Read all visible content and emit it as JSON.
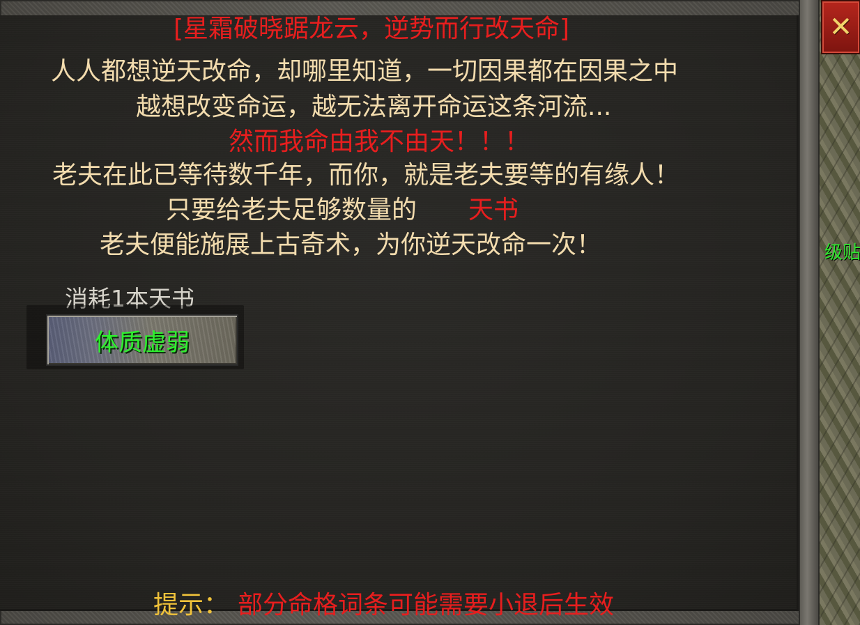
{
  "dialog": {
    "title": "[星霜破晓踞龙云，逆势而行改天命]",
    "lines": [
      "人人都想逆天改命，却哪里知道，一切因果都在因果之中",
      "越想改变命运，越无法离开命运这条河流...",
      "然而我命由我不由天！！！",
      "老夫在此已等待数千年，而你，就是老夫要等的有缘人！",
      "只要给老夫足够数量的",
      "天书",
      "老夫便能施展上古奇术，为你逆天改命一次！"
    ],
    "cost_label": "消耗1本天书",
    "action_button": "体质虚弱",
    "hint_prefix": "提示：",
    "hint_text": "部分命格词条可能需要小退后生效"
  },
  "close_icon": "close-x-icon",
  "map_label": "级贴",
  "colors": {
    "red": "#e71e1e",
    "cream": "#f3dcae",
    "green": "#2ef02e",
    "gold": "#f0c23a"
  }
}
